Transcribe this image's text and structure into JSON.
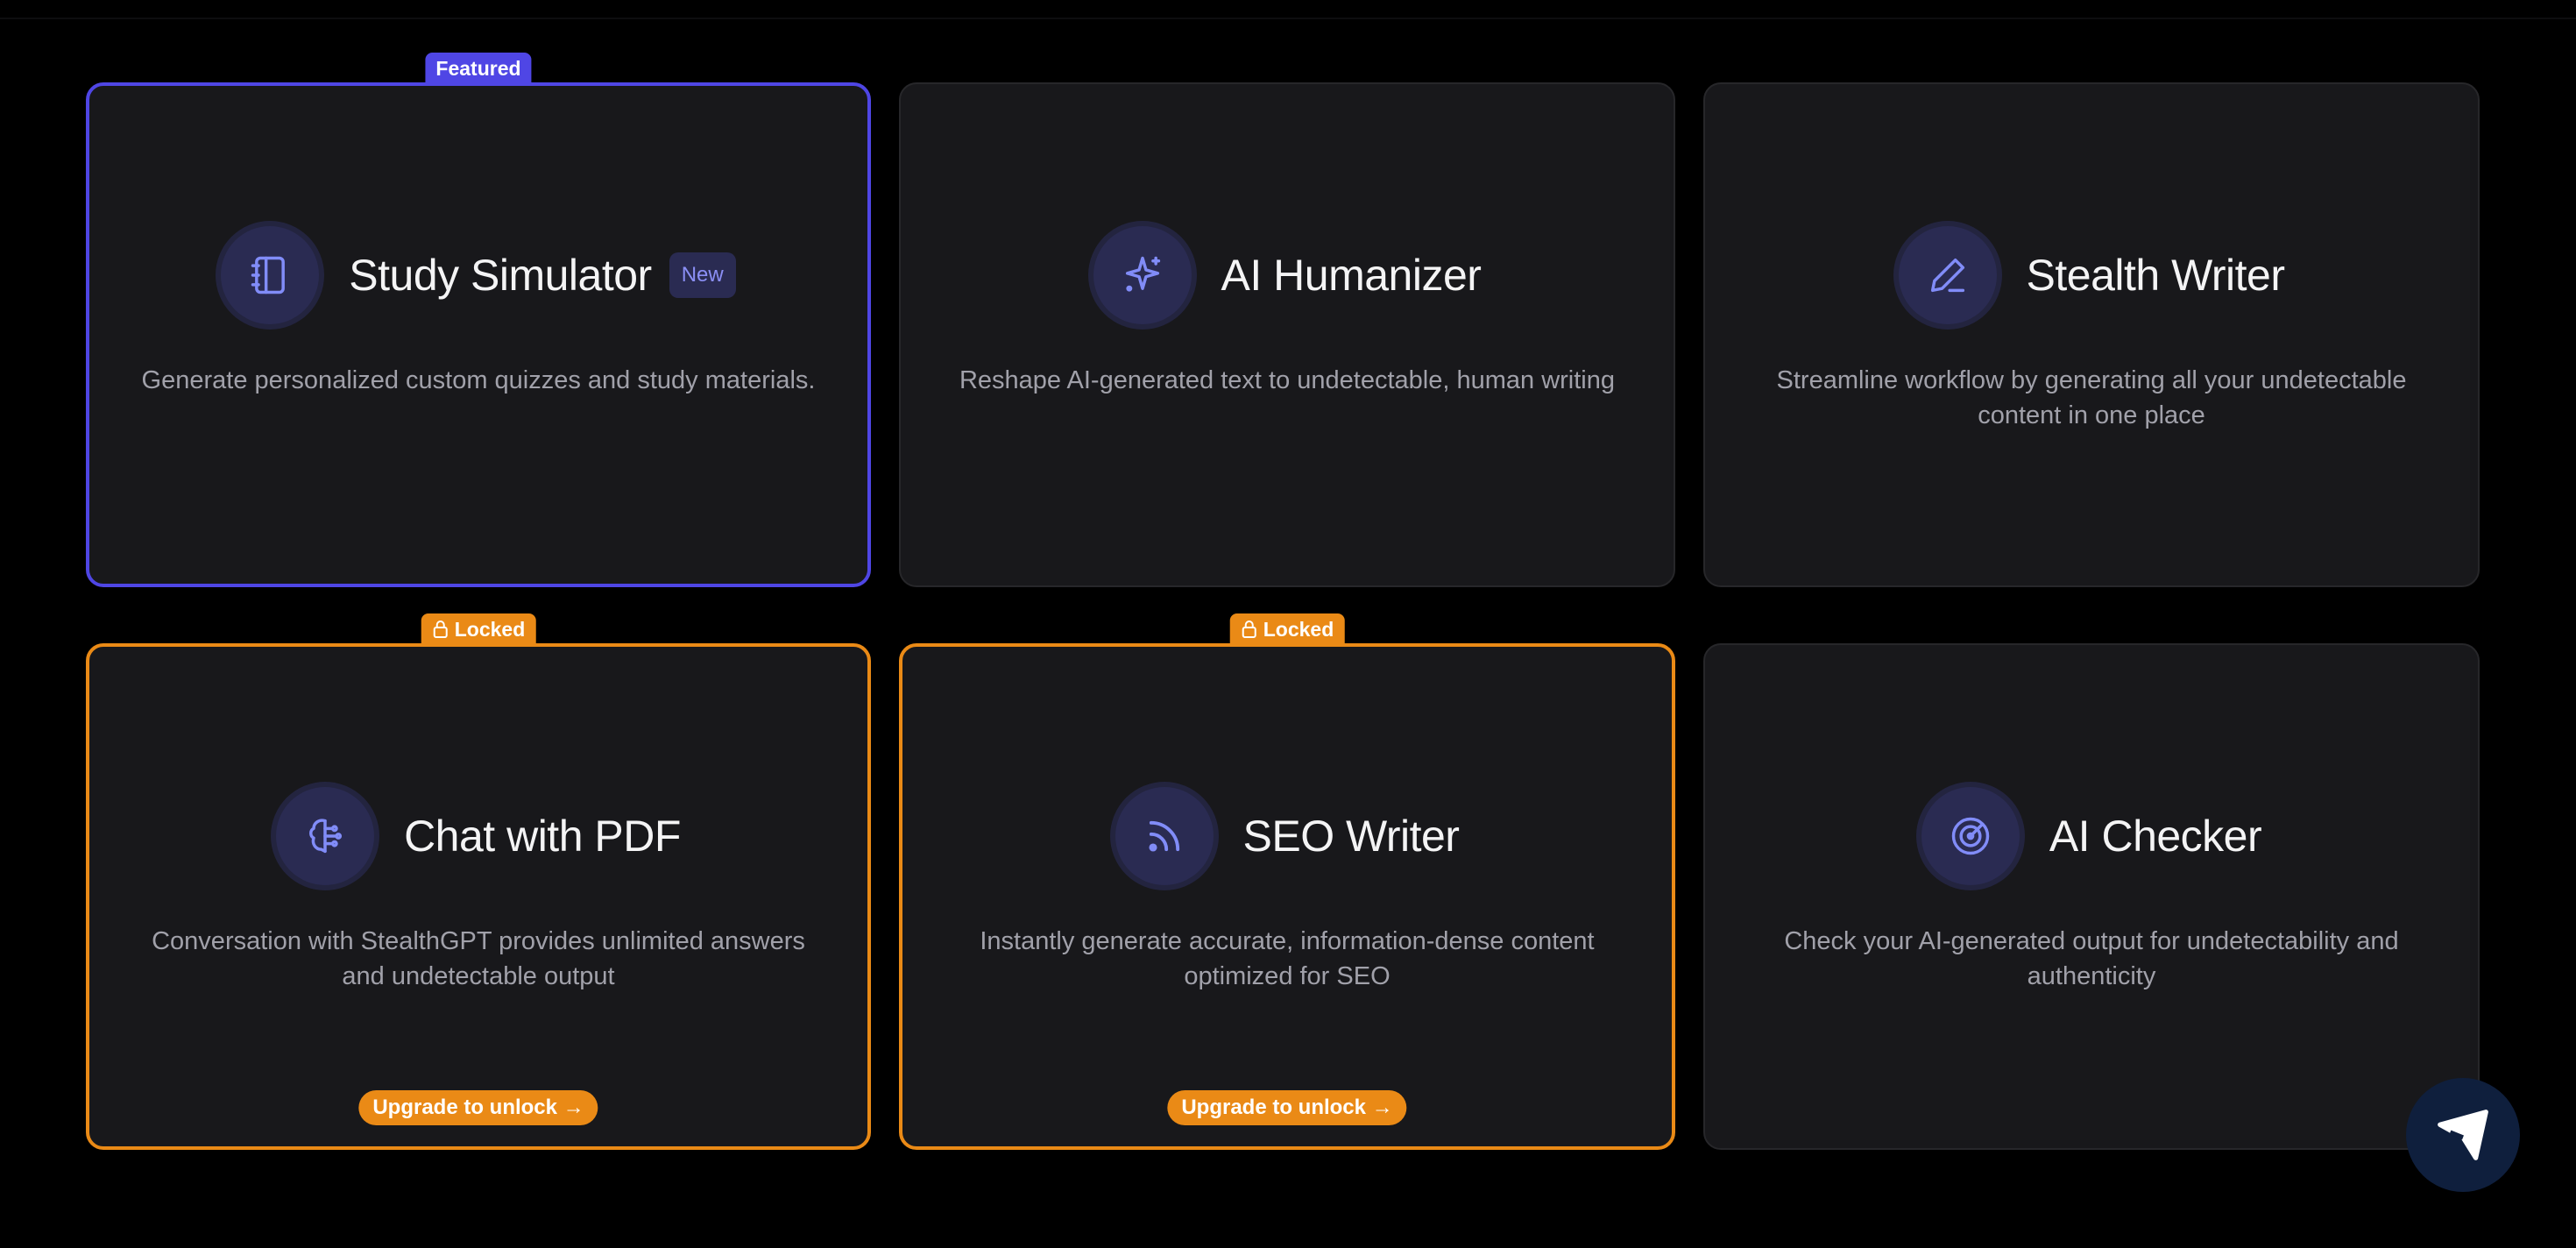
{
  "colors": {
    "background": "#000000",
    "card": "#18181b",
    "accent": "#4f46e5",
    "locked": "#ea8a16",
    "icon_color": "#818cf8"
  },
  "cards": [
    {
      "title": "Study Simulator",
      "badge": "New",
      "top_badge": "Featured",
      "description": "Generate personalized custom quizzes and study materials.",
      "icon": "notebook-icon",
      "state": "featured"
    },
    {
      "title": "AI Humanizer",
      "description": "Reshape AI-generated text to undetectable, human writing",
      "icon": "sparkles-icon",
      "state": "normal"
    },
    {
      "title": "Stealth Writer",
      "description": "Streamline workflow by generating all your undetectable content in one place",
      "icon": "pencil-icon",
      "state": "normal"
    },
    {
      "title": "Chat with PDF",
      "top_badge": "Locked",
      "description": "Conversation with StealthGPT provides unlimited answers and undetectable output",
      "icon": "brain-icon",
      "state": "locked",
      "upgrade_label": "Upgrade to unlock →"
    },
    {
      "title": "SEO Writer",
      "top_badge": "Locked",
      "description": "Instantly generate accurate, information-dense content optimized for SEO",
      "icon": "rss-icon",
      "state": "locked",
      "upgrade_label": "Upgrade to unlock →"
    },
    {
      "title": "AI Checker",
      "description": "Check your AI-generated output for undetectability and authenticity",
      "icon": "radar-icon",
      "state": "normal"
    }
  ],
  "fab": {
    "icon": "paper-plane-icon"
  }
}
